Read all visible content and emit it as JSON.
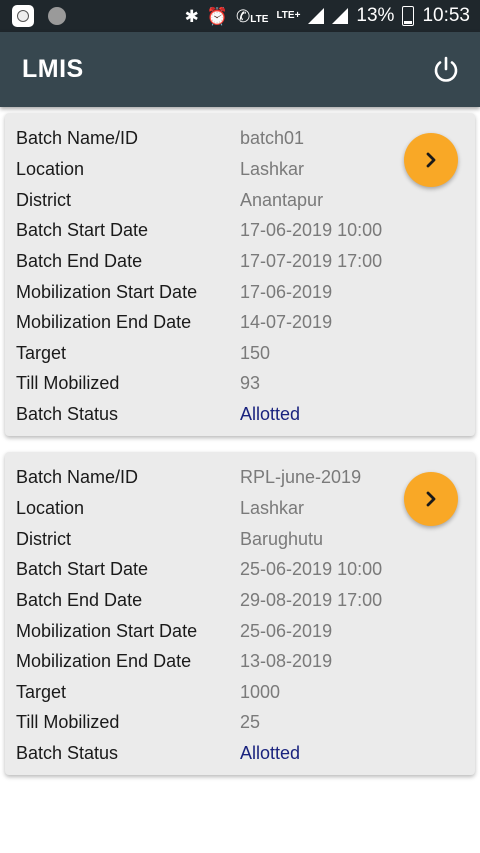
{
  "status_bar": {
    "lte1": "LTE",
    "lte2": "LTE+",
    "battery": "13%",
    "time": "10:53"
  },
  "app": {
    "title": "LMIS"
  },
  "labels": {
    "batch_name": "Batch Name/ID",
    "location": "Location",
    "district": "District",
    "batch_start": "Batch Start Date",
    "batch_end": "Batch End Date",
    "mob_start": "Mobilization Start Date",
    "mob_end": "Mobilization End Date",
    "target": "Target",
    "till_mobilized": "Till Mobilized",
    "batch_status": "Batch Status"
  },
  "batches": [
    {
      "batch_name": "batch01",
      "location": "Lashkar",
      "district": "Anantapur",
      "batch_start": "17-06-2019 10:00",
      "batch_end": "17-07-2019 17:00",
      "mob_start": "17-06-2019",
      "mob_end": "14-07-2019",
      "target": "150",
      "till_mobilized": "93",
      "batch_status": "Allotted"
    },
    {
      "batch_name": "RPL-june-2019",
      "location": "Lashkar",
      "district": "Barughutu",
      "batch_start": "25-06-2019 10:00",
      "batch_end": "29-08-2019 17:00",
      "mob_start": "25-06-2019",
      "mob_end": "13-08-2019",
      "target": "1000",
      "till_mobilized": "25",
      "batch_status": "Allotted"
    }
  ],
  "colors": {
    "app_bar": "#37474f",
    "status_bar": "#1f272c",
    "accent": "#f9a826",
    "status_text": "#1a237e"
  },
  "icons": {
    "power": "power-icon",
    "arrow": "chevron-right-icon"
  }
}
